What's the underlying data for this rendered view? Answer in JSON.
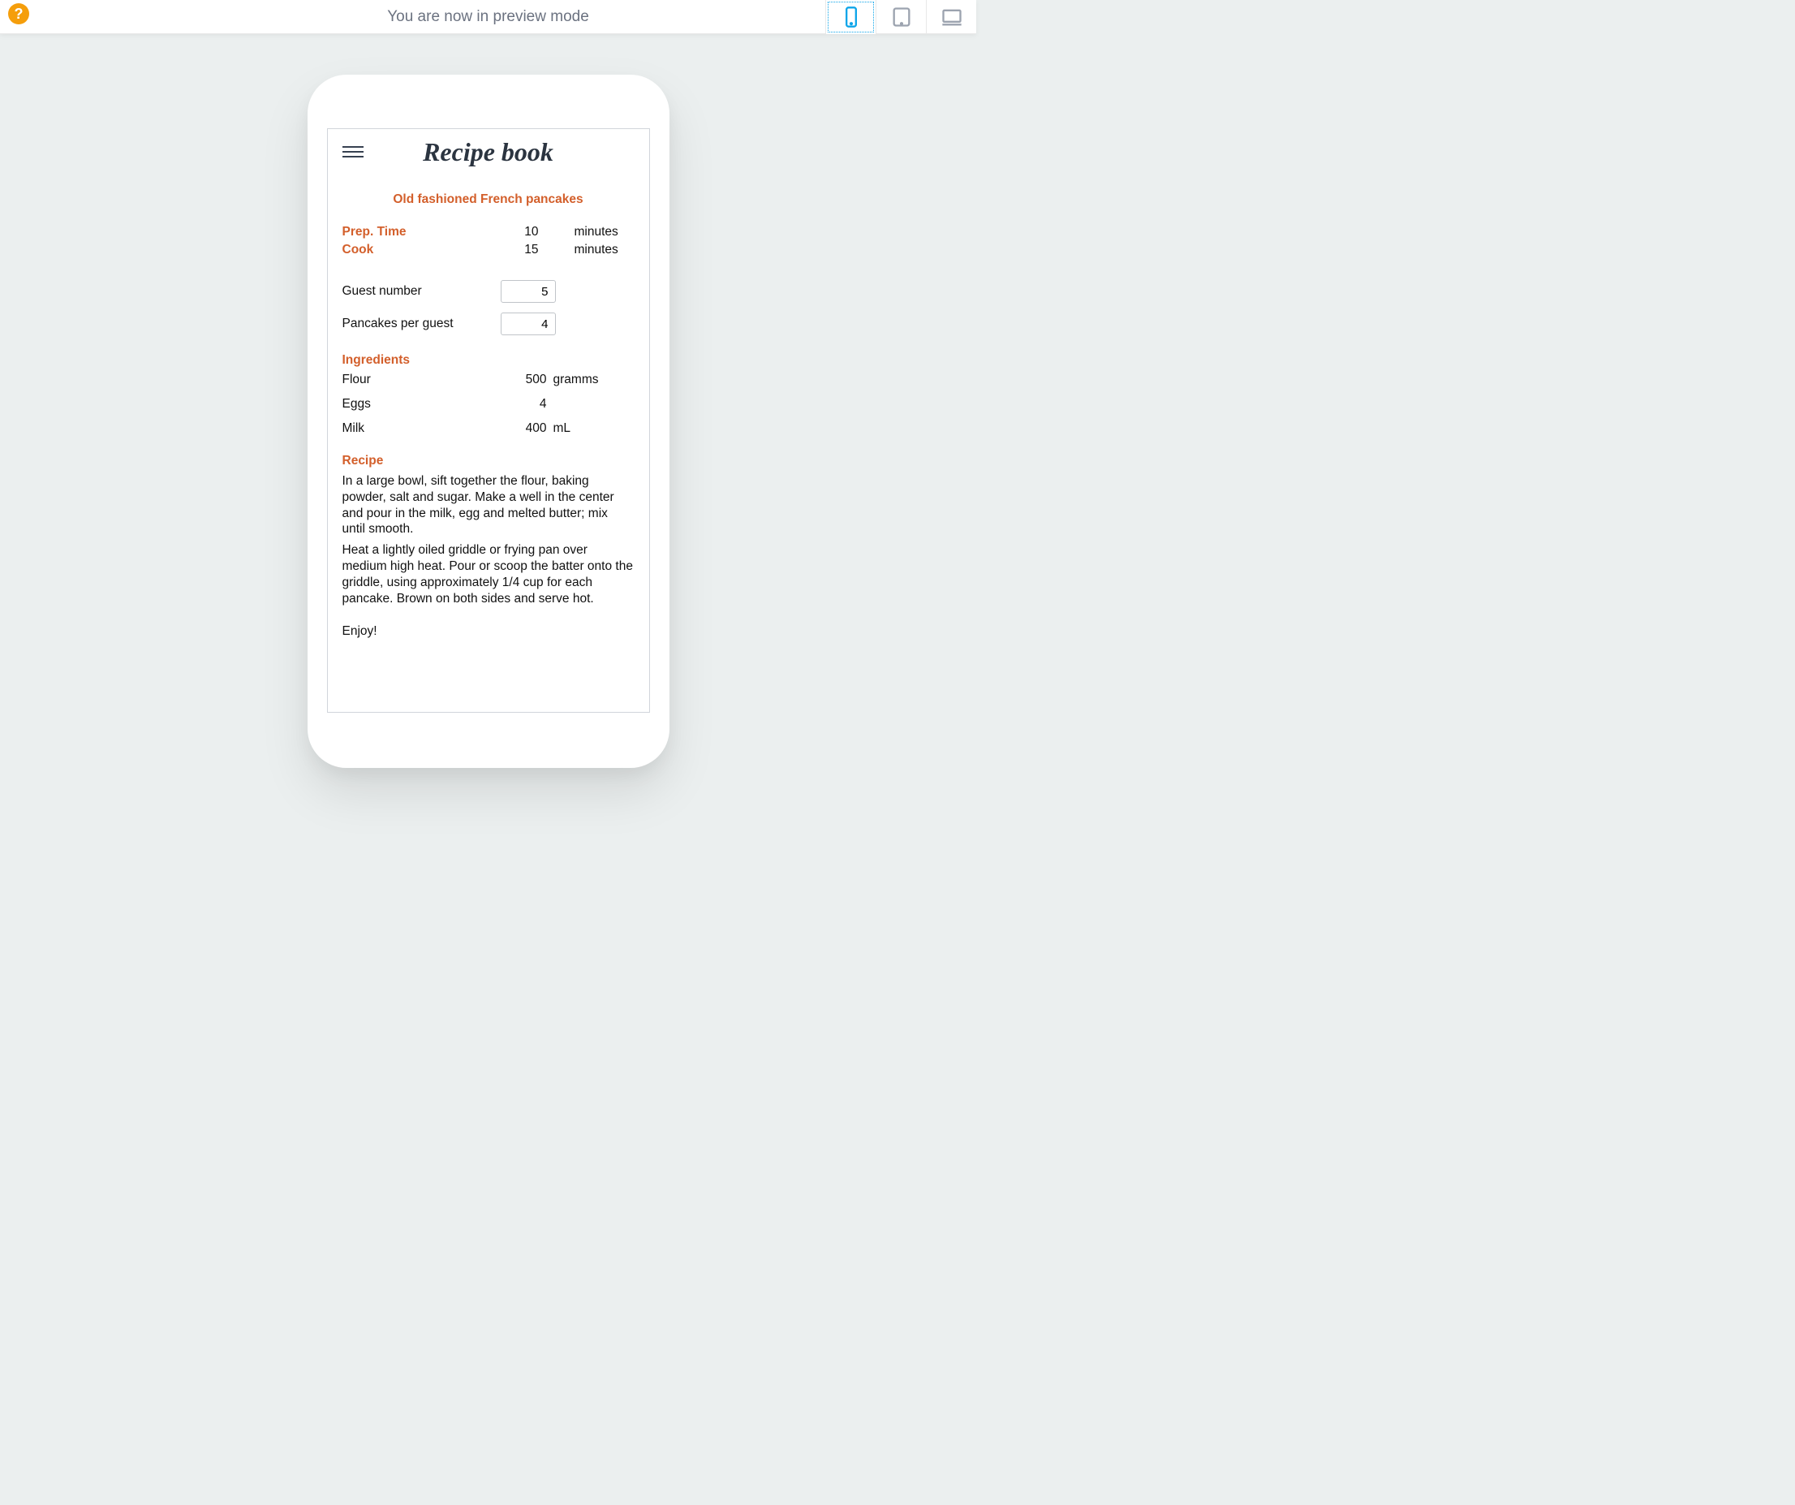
{
  "topbar": {
    "help_label": "?",
    "title": "You are now in preview mode"
  },
  "app": {
    "title": "Recipe book",
    "recipe_title": "Old fashioned French pancakes",
    "times": {
      "prep_label": "Prep. Time",
      "prep_value": "10",
      "prep_unit": "minutes",
      "cook_label": "Cook",
      "cook_value": "15",
      "cook_unit": "minutes"
    },
    "inputs": {
      "guest_label": "Guest number",
      "guest_value": "5",
      "pancakes_label": "Pancakes per guest",
      "pancakes_value": "4"
    },
    "ingredients_heading": "Ingredients",
    "ingredients": [
      {
        "name": "Flour",
        "qty": "500",
        "unit": "gramms"
      },
      {
        "name": "Eggs",
        "qty": "4",
        "unit": ""
      },
      {
        "name": "Milk",
        "qty": "400",
        "unit": "mL"
      }
    ],
    "recipe_heading": "Recipe",
    "recipe_steps": [
      "In a large bowl, sift together the flour, baking powder, salt and sugar. Make a well in the center and pour in the milk, egg and melted butter; mix until smooth.",
      "Heat a lightly oiled griddle or frying pan over medium high heat. Pour or scoop the batter onto the griddle, using approximately 1/4 cup for each pancake. Brown on both sides and serve hot."
    ],
    "enjoy": "Enjoy!"
  }
}
